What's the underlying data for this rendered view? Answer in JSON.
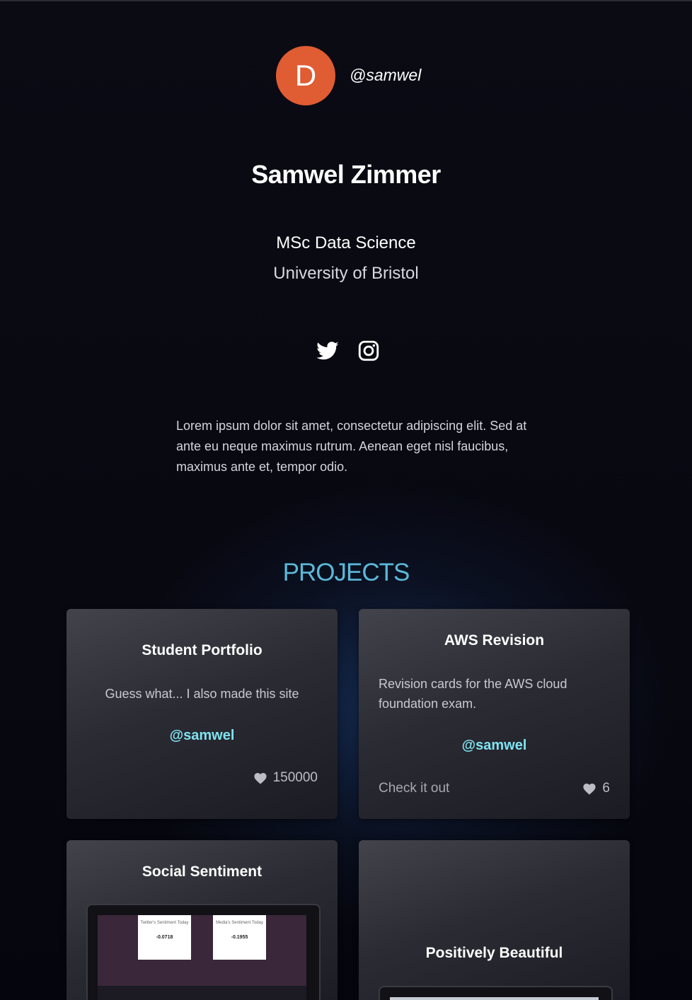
{
  "profile": {
    "avatar_initial": "D",
    "handle": "@samwel",
    "name": "Samwel Zimmer",
    "degree": "MSc Data Science",
    "university": "University of Bristol",
    "bio": "Lorem ipsum dolor sit amet, consectetur adipiscing elit. Sed at ante eu neque maximus rutrum. Aenean eget nisl faucibus, maximus ante et, tempor odio.",
    "socials": [
      {
        "icon": "twitter-icon"
      },
      {
        "icon": "instagram-icon"
      }
    ]
  },
  "projects": {
    "title": "PROJECTS",
    "cards": [
      {
        "title": "Student Portfolio",
        "description": "Guess what... I also made this site",
        "handle": "@samwel",
        "likes": "150000"
      },
      {
        "title": "AWS Revision",
        "description": "Revision cards for the AWS cloud foundation exam.",
        "handle": "@samwel",
        "link": "Check it out",
        "likes": "6"
      },
      {
        "title": "Social Sentiment",
        "preview": {
          "cards": [
            {
              "label": "Twitter's Sentiment Today",
              "value": "-0.0718"
            },
            {
              "label": "Media's Sentiment Today",
              "value": "-0.1955"
            }
          ]
        }
      },
      {
        "title": "Positively Beautiful"
      }
    ]
  },
  "colors": {
    "avatar": "#e05c33",
    "accent_handle": "#7fe3f0",
    "projects_heading": "#5bb8d8",
    "preview_screen": "#3a2739"
  }
}
